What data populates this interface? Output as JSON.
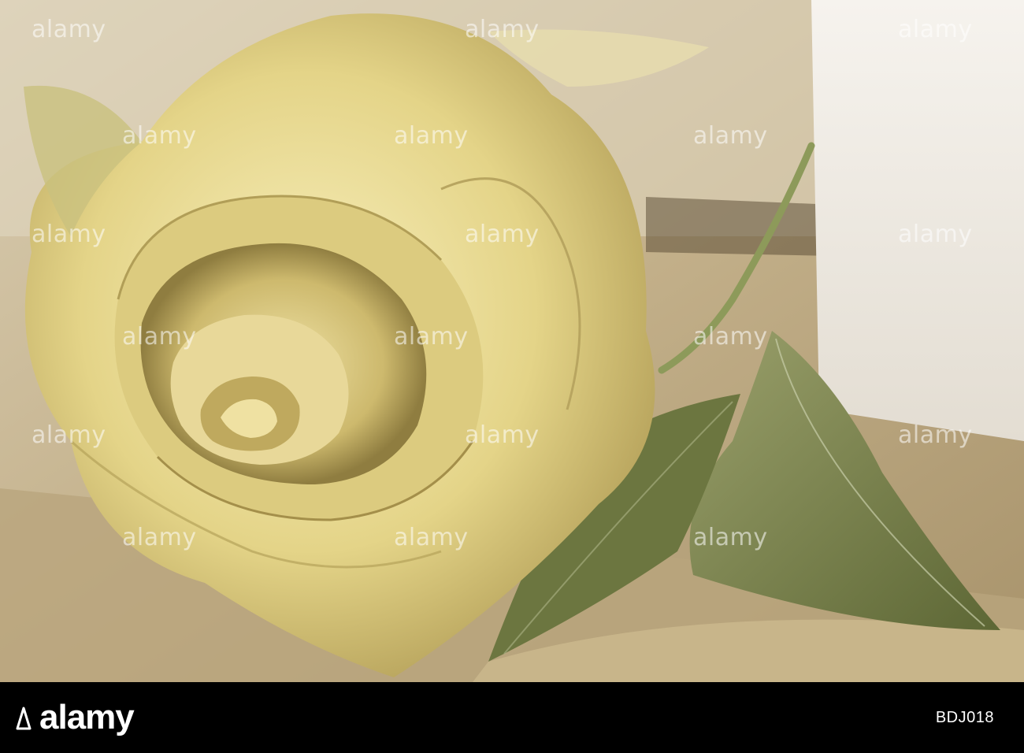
{
  "photo": {
    "subject": "dried yellow rose with leaves",
    "colors": {
      "background": "#c8b590",
      "paper": "#f0ece4",
      "petal_light": "#f2e6a8",
      "petal_mid": "#d9c77a",
      "petal_shadow": "#9c8a4a",
      "leaf": "#7f8a55",
      "leaf_dark": "#4f5a2e"
    }
  },
  "watermarks": {
    "text": "alamy"
  },
  "footer": {
    "brand": "alamy",
    "brand_icon": "alamy-logo-icon",
    "image_id": "BDJ018",
    "bar_color": "#000000"
  }
}
